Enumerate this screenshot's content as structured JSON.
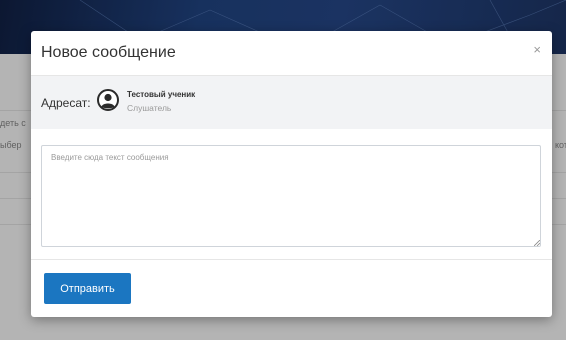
{
  "background": {
    "left_fragments": [
      "деть с",
      "ыбер"
    ],
    "right_fragment": "кот"
  },
  "modal": {
    "title": "Новое сообщение",
    "close_glyph": "×",
    "recipient": {
      "label": "Адресат:",
      "name": "Тестовый ученик",
      "role": "Слушатель",
      "avatar_icon": "user-avatar-icon"
    },
    "message": {
      "value": "",
      "placeholder": "Введите сюда текст сообщения"
    },
    "send_label": "Отправить"
  },
  "colors": {
    "primary_button": "#1b76c1",
    "recipient_bg": "#f2f3f5",
    "header_bg": "#1d3c73"
  }
}
